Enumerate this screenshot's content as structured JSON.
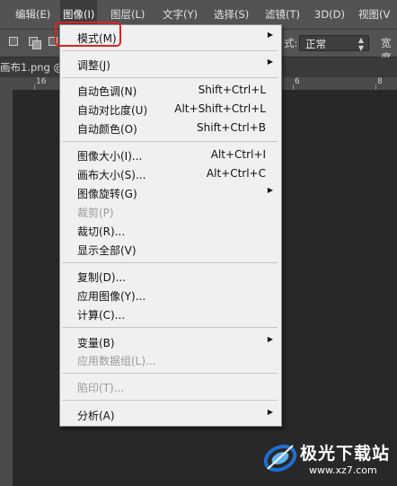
{
  "menubar": {
    "items": [
      {
        "label": "编辑(E)"
      },
      {
        "label": "图像(I)"
      },
      {
        "label": "图层(L)"
      },
      {
        "label": "文字(Y)"
      },
      {
        "label": "选择(S)"
      },
      {
        "label": "滤镜(T)"
      },
      {
        "label": "3D(D)"
      },
      {
        "label": "视图(V"
      }
    ]
  },
  "options": {
    "mode_select": "正常",
    "mode_prefix": "式:",
    "width_fragment": "宽度"
  },
  "document": {
    "tab": "画布1.png @"
  },
  "ruler": {
    "labels": [
      "16",
      "6",
      "8"
    ]
  },
  "image_menu": {
    "items": [
      {
        "label": "模式(M)"
      },
      {
        "label": "调整(J)"
      },
      {
        "label": "自动色调(N)",
        "shortcut": "Shift+Ctrl+L"
      },
      {
        "label": "自动对比度(U)",
        "shortcut": "Alt+Shift+Ctrl+L"
      },
      {
        "label": "自动颜色(O)",
        "shortcut": "Shift+Ctrl+B"
      },
      {
        "label": "图像大小(I)...",
        "shortcut": "Alt+Ctrl+I"
      },
      {
        "label": "画布大小(S)...",
        "shortcut": "Alt+Ctrl+C"
      },
      {
        "label": "图像旋转(G)"
      },
      {
        "label": "裁剪(P)"
      },
      {
        "label": "裁切(R)..."
      },
      {
        "label": "显示全部(V)"
      },
      {
        "label": "复制(D)..."
      },
      {
        "label": "应用图像(Y)..."
      },
      {
        "label": "计算(C)..."
      },
      {
        "label": "变量(B)"
      },
      {
        "label": "应用数据组(L)..."
      },
      {
        "label": "陷印(T)..."
      },
      {
        "label": "分析(A)"
      }
    ],
    "submenu_arrow": "▶"
  },
  "watermark": {
    "name": "极光下载站",
    "url": "www.xz7.com",
    "colors": {
      "logo_blue": "#1f6fd1",
      "logo_light": "#5fb4f0"
    }
  },
  "colors": {
    "highlight": "#e0221e",
    "menubar": "#535353",
    "canvas": "#282828",
    "menu_bg": "#f0f0f0"
  }
}
